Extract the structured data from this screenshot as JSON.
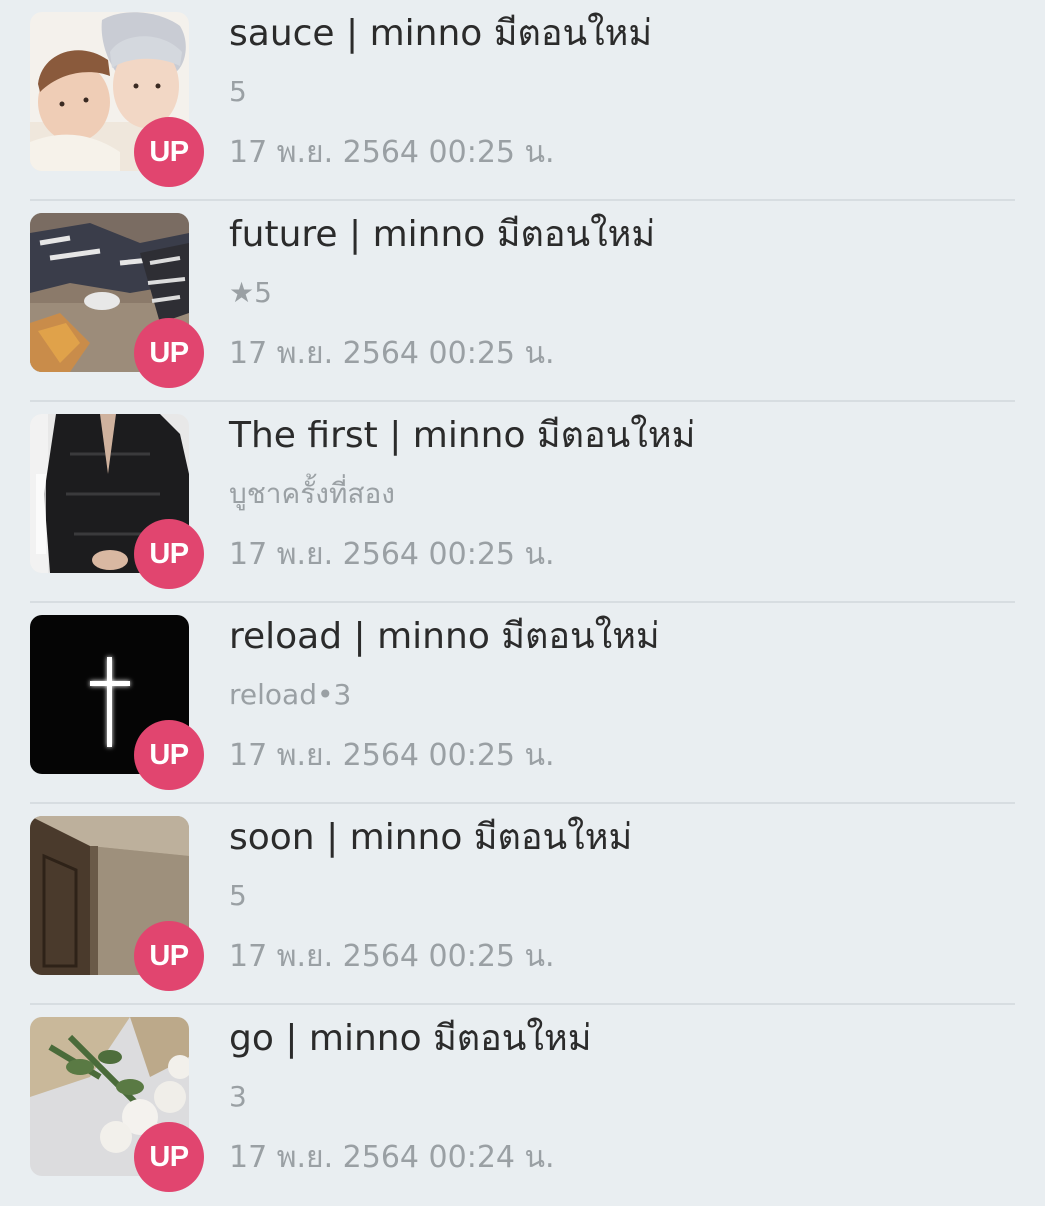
{
  "badge_color": "#e1456f",
  "items": [
    {
      "title": "sauce | minno มีตอนใหม่",
      "subtitle": "5",
      "date": "17 พ.ย. 2564 00:25 น.",
      "badge": "UP",
      "thumbnail": "two-people-photo"
    },
    {
      "title": "future | minno มีตอนใหม่",
      "subtitle": "★5",
      "date": "17 พ.ย. 2564 00:25 น.",
      "badge": "UP",
      "thumbnail": "gaming-photo"
    },
    {
      "title": "The first | minno มีตอนใหม่",
      "subtitle": "บูชาครั้งที่สอง",
      "date": "17 พ.ย. 2564 00:25 น.",
      "badge": "UP",
      "thumbnail": "black-outfit-photo"
    },
    {
      "title": "reload | minno มีตอนใหม่",
      "subtitle": "reload•3",
      "date": "17 พ.ย. 2564 00:25 น.",
      "badge": "UP",
      "thumbnail": "glowing-cross-image"
    },
    {
      "title": "soon | minno มีตอนใหม่",
      "subtitle": "5",
      "date": "17 พ.ย. 2564 00:25 น.",
      "badge": "UP",
      "thumbnail": "door-photo"
    },
    {
      "title": "go | minno มีตอนใหม่",
      "subtitle": "3",
      "date": "17 พ.ย. 2564 00:24 น.",
      "badge": "UP",
      "thumbnail": "white-roses-photo"
    }
  ]
}
